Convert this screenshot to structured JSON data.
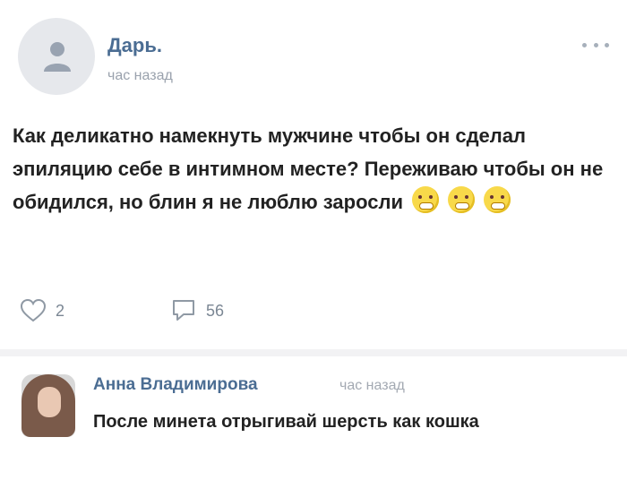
{
  "post": {
    "author": "Дарь.",
    "time": "час назад",
    "text": "Как деликатно намекнуть мужчине чтобы он сделал эпиляцию себе в интимном месте? Переживаю чтобы он не обидился, но блин я не люблю заросли",
    "emoji_count": 3,
    "likes": "2",
    "comments": "56"
  },
  "comment": {
    "author": "Анна Владимирова",
    "time": "час назад",
    "text": "После минета отрыгивай шерсть как кошка"
  },
  "icons": {
    "more": "more-icon",
    "like": "heart-icon",
    "comment": "comment-icon",
    "emoji": "grimace-emoji-icon"
  },
  "colors": {
    "author_link": "#4b6d93",
    "muted": "#9aa2ad",
    "text": "#222222",
    "emoji": "#f8d94a"
  }
}
